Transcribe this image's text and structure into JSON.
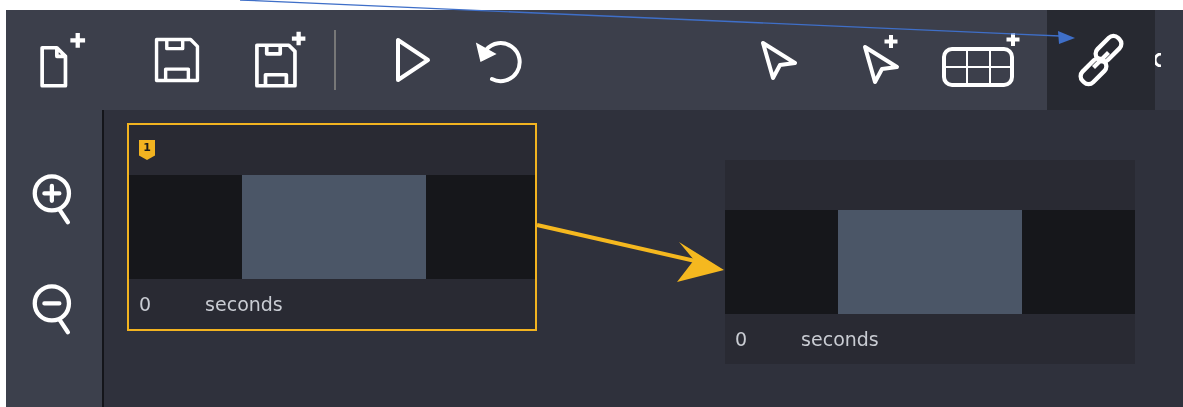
{
  "toolbar": {
    "left": [
      {
        "kind": "new-file",
        "selected": false
      },
      {
        "kind": "save",
        "selected": false
      },
      {
        "kind": "save-as",
        "selected": false
      },
      {
        "kind": "play",
        "selected": false
      },
      {
        "kind": "undo",
        "selected": false
      }
    ],
    "right": [
      {
        "kind": "pointer",
        "selected": false
      },
      {
        "kind": "pointer-plus",
        "selected": false
      },
      {
        "kind": "table-plus",
        "selected": false
      },
      {
        "kind": "link",
        "selected": true
      }
    ]
  },
  "sidebar": {
    "buttons": [
      {
        "kind": "zoom-in"
      },
      {
        "kind": "zoom-out"
      }
    ]
  },
  "nodes": [
    {
      "selected": true,
      "badge": "1",
      "time": "0",
      "unit": "seconds"
    },
    {
      "selected": false,
      "time": "0",
      "unit": "seconds"
    }
  ]
}
